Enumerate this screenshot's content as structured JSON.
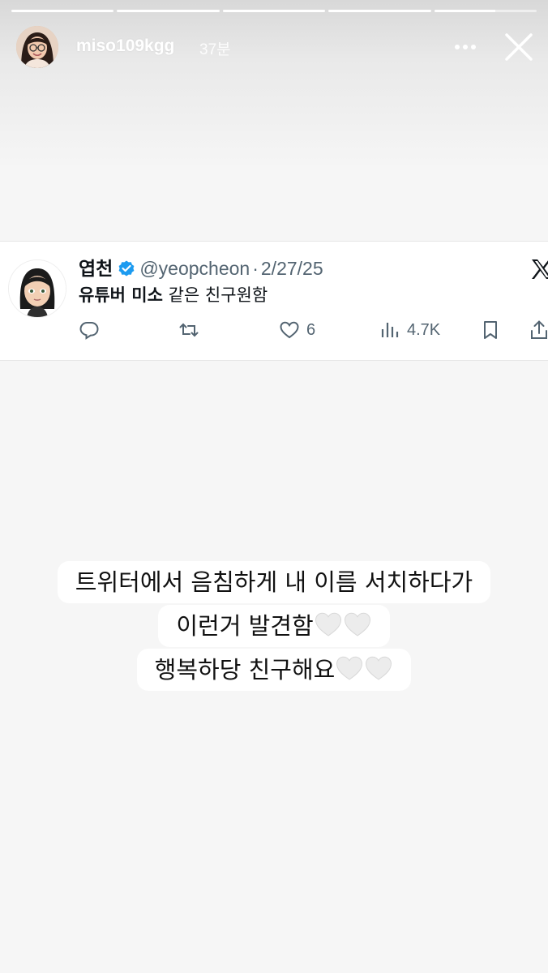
{
  "story": {
    "progress": [
      1,
      1,
      1,
      1,
      0.6
    ],
    "user": {
      "username": "miso109kgg",
      "time_ago": "37분",
      "avatar_icon": "profile-photo"
    },
    "controls": {
      "more_icon": "more-dots-icon",
      "close_icon": "close-icon"
    }
  },
  "tweet": {
    "name": "엽천",
    "handle": "@yeopcheon",
    "separator": "·",
    "date": "2/27/25",
    "text_bold": "유튜버 미소",
    "text_rest": " 같은 친구원함",
    "likes": "6",
    "views": "4.7K",
    "brand": "x-logo",
    "accent_color": "#1d9bf0"
  },
  "caption": {
    "line1": "트위터에서 음침하게 내 이름 서치하다가",
    "line2": "이런거 발견함",
    "line3": "행복하당 친구해요",
    "heart_color": "#e8e8e8"
  }
}
